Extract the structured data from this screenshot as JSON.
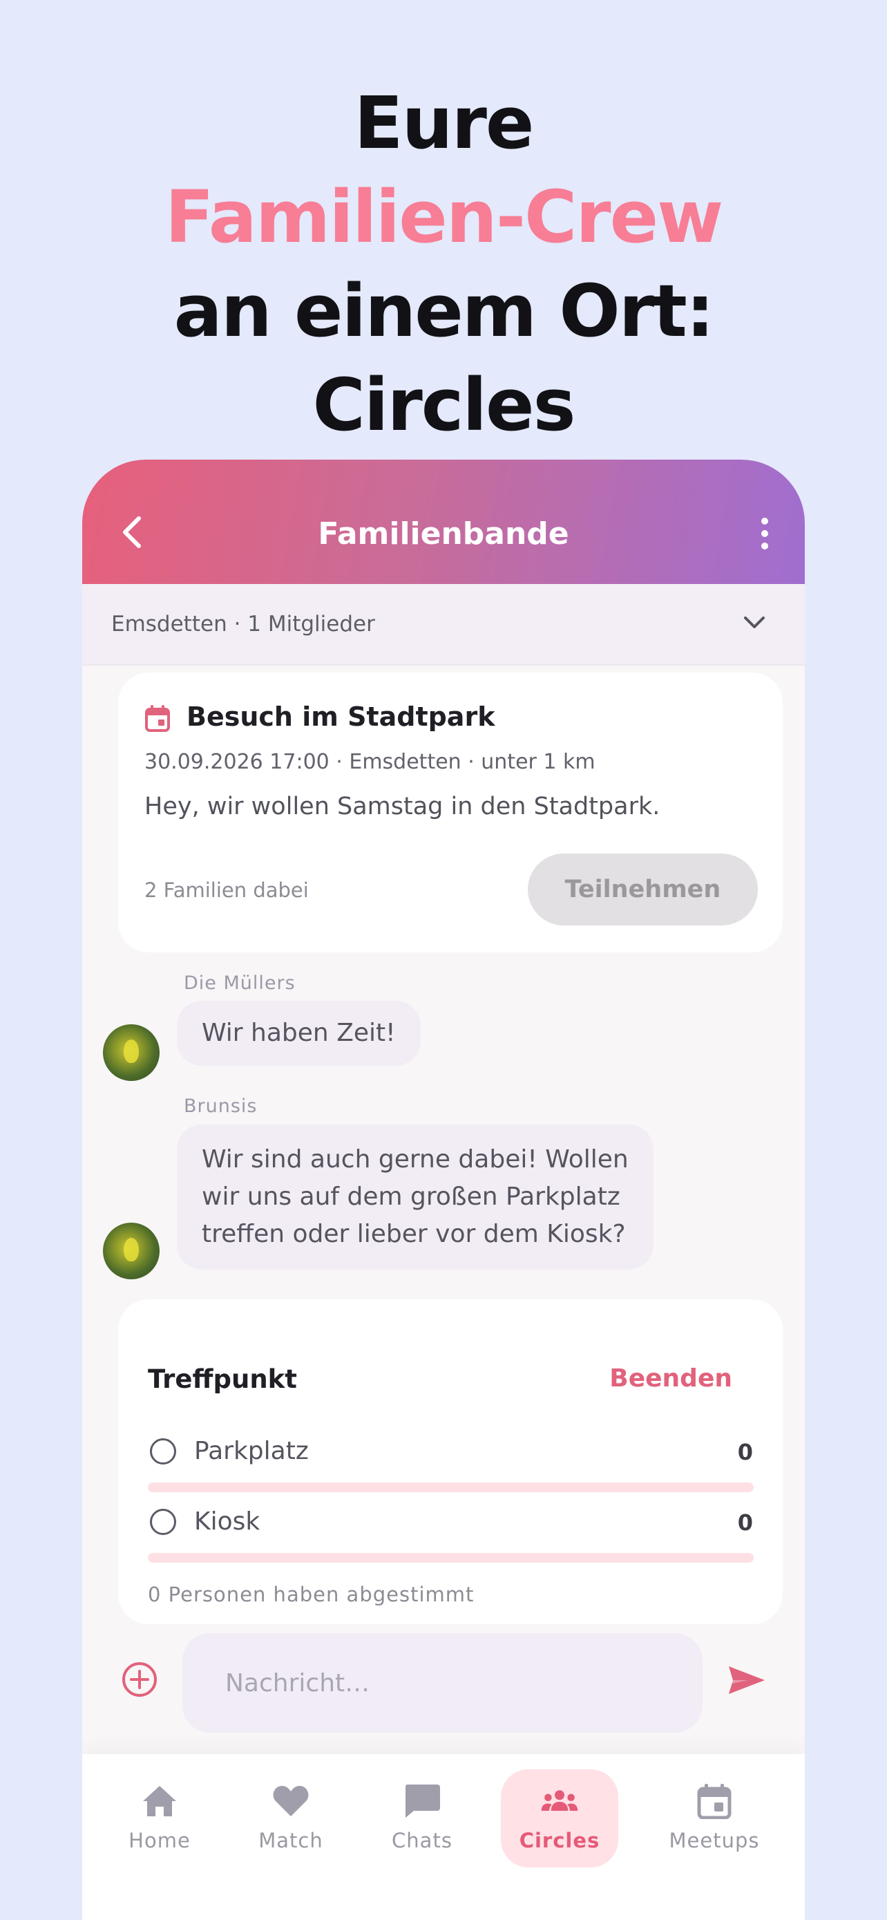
{
  "headline": {
    "line1": "Eure",
    "line2": "Familien-Crew",
    "line3": "an einem Ort:",
    "line4": "Circles"
  },
  "appbar": {
    "title": "Familienbande",
    "back_icon": "chevron-left-icon",
    "more_icon": "more-vertical-icon"
  },
  "circle_info": {
    "text": "Emsdetten · 1 Mitglieder",
    "expand_icon": "chevron-down-icon"
  },
  "event_card": {
    "icon": "calendar-icon",
    "title": "Besuch im Stadtpark",
    "meta": "30.09.2026 17:00 · Emsdetten · unter 1 km",
    "description": "Hey, wir wollen Samstag in den Stadtpark.",
    "participants": "2 Familien dabei",
    "join_label": "Teilnehmen"
  },
  "messages": [
    {
      "sender": "Die Müllers",
      "text": "Wir haben Zeit!"
    },
    {
      "sender": "Brunsis",
      "lines": [
        "Wir sind auch gerne dabei! Wollen",
        "wir uns auf dem großen Parkplatz",
        "treffen oder lieber vor dem Kiosk?"
      ]
    }
  ],
  "poll": {
    "title": "Treffpunkt",
    "end_label": "Beenden",
    "options": [
      {
        "label": "Parkplatz",
        "count": "0",
        "share": 0
      },
      {
        "label": "Kiosk",
        "count": "0",
        "share": 0
      }
    ],
    "voters": "0 Personen haben abgestimmt"
  },
  "composer": {
    "placeholder": "Nachricht…",
    "add_icon": "add-circle-icon",
    "send_icon": "send-icon"
  },
  "tabs": [
    {
      "label": "Home",
      "icon": "home-icon",
      "active": false
    },
    {
      "label": "Match",
      "icon": "heart-icon",
      "active": false
    },
    {
      "label": "Chats",
      "icon": "chat-bubble-icon",
      "active": false
    },
    {
      "label": "Circles",
      "icon": "group-icon",
      "active": true
    },
    {
      "label": "Meetups",
      "icon": "calendar-icon",
      "active": false
    }
  ],
  "colors": {
    "accent": "#e1627c",
    "headline_accent": "#f77e95",
    "background": "#e4e9fb",
    "gradient_start": "#e7607c",
    "gradient_end": "#a06ed0"
  }
}
